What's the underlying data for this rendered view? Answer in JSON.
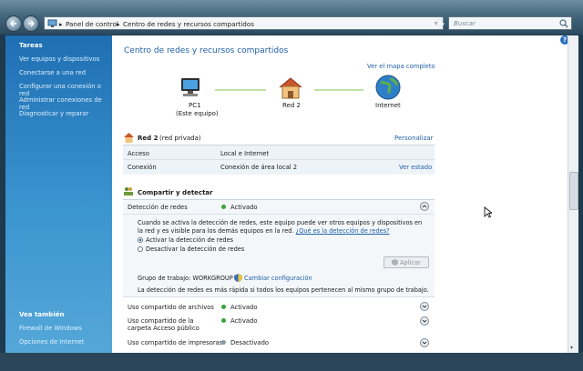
{
  "address": {
    "crumbs": [
      "Panel de control",
      "Centro de redes y recursos compartidos"
    ],
    "search_placeholder": "Buscar"
  },
  "sidebar": {
    "tasks_title": "Tareas",
    "tasks": [
      "Ver equipos y dispositivos",
      "Conectarse a una red",
      "Configurar una conexión o red",
      "Administrar conexiones de red",
      "Diagnosticar y reparar"
    ],
    "see_also_title": "Vea también",
    "see_also": [
      "Firewall de Windows",
      "Opciones de Internet"
    ]
  },
  "main": {
    "title": "Centro de redes y recursos compartidos",
    "full_map_link": "Ver el mapa completo",
    "map": {
      "pc_label": "PC1",
      "pc_sublabel": "(Este equipo)",
      "network_label": "Red 2",
      "internet_label": "Internet"
    },
    "network": {
      "name": "Red 2",
      "type": "(red privada)",
      "customize": "Personalizar",
      "rows": [
        {
          "label": "Acceso",
          "value": "Local e Internet",
          "action": ""
        },
        {
          "label": "Conexión",
          "value": "Conexión de área local 2",
          "action": "Ver estado"
        }
      ]
    },
    "sharing": {
      "title": "Compartir y detectar",
      "discovery": {
        "label": "Detección de redes",
        "status": "Activado",
        "description": "Cuando se activa la detección de redes, este equipo puede ver otros equipos y dispositivos en la red y es visible para los demás equipos en la red.",
        "help_link": "¿Qué es la detección de redes?",
        "options": [
          "Activar la detección de redes",
          "Desactivar la detección de redes"
        ],
        "selected": 0,
        "apply": "Aplicar",
        "workgroup_label": "Grupo de trabajo: WORKGROUP",
        "change_config": "Cambiar configuración",
        "note": "La detección de redes es más rápida si todos los equipos pertenecen al mismo grupo de trabajo."
      },
      "rows": [
        {
          "label": "Uso compartido de archivos",
          "status": "Activado",
          "on": true
        },
        {
          "label": "Uso compartido de la carpeta Acceso público",
          "status": "Activado",
          "on": true
        },
        {
          "label": "Uso compartido de impresoras",
          "status": "Desactivado",
          "on": false
        }
      ]
    }
  },
  "colors": {
    "accent": "#1f5fa8",
    "sidebar": "#2f86c6",
    "on": "#3aa53a",
    "off": "#8e9aa3"
  }
}
